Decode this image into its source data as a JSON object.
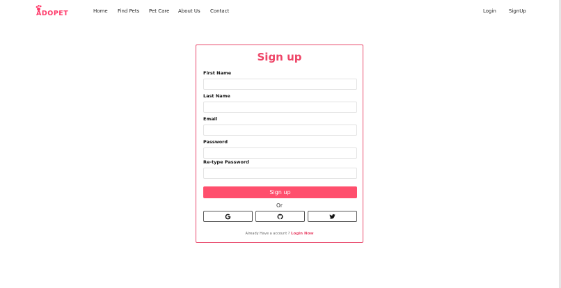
{
  "brand": {
    "name": "ADOPET",
    "accent_color": "#ff3b6b"
  },
  "nav": {
    "home": "Home",
    "find_pets": "Find Pets",
    "pet_care": "Pet Care",
    "about_us": "About Us",
    "contact": "Contact",
    "login": "Login",
    "signup": "SignUp"
  },
  "form": {
    "title": "Sign up",
    "fields": {
      "first_name": {
        "label": "First Name",
        "value": "",
        "placeholder": ""
      },
      "last_name": {
        "label": "Last Name",
        "value": "",
        "placeholder": ""
      },
      "email": {
        "label": "Email",
        "value": "",
        "placeholder": ""
      },
      "password": {
        "label": "Password",
        "value": "",
        "placeholder": ""
      },
      "retype_password": {
        "label": "Re-type Password",
        "value": "",
        "placeholder": ""
      }
    },
    "submit_label": "Sign up",
    "or_text": "Or",
    "social": [
      "google-icon",
      "github-icon",
      "twitter-icon"
    ],
    "footer_text": "Already Have a account ? ",
    "footer_link": "Login Now"
  }
}
